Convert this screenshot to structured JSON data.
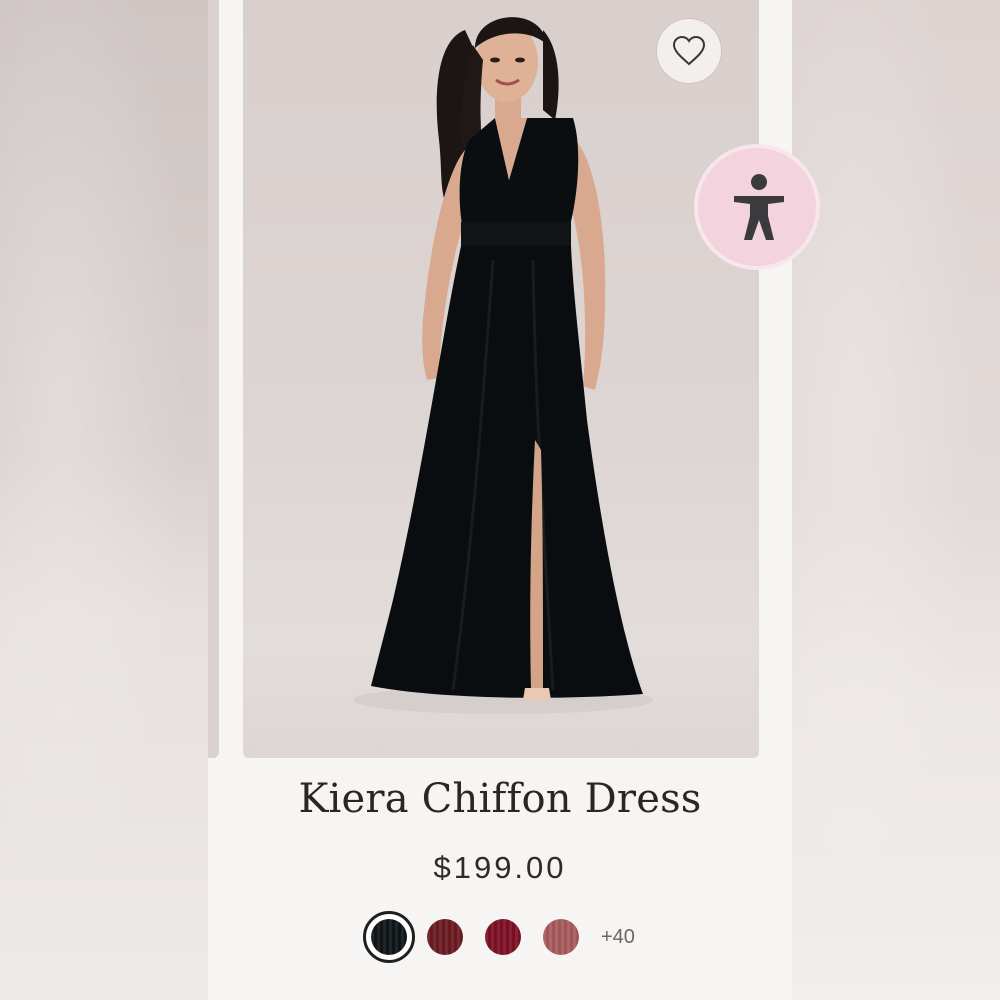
{
  "product": {
    "name": "Kiera Chiffon Dress",
    "price": "$199.00",
    "image_alt": "Model wearing a black V-neck chiffon maxi dress with front slit"
  },
  "actions": {
    "wishlist_icon": "heart-outline-icon",
    "accessibility_icon": "accessibility-person-icon"
  },
  "swatches": {
    "colors": [
      "#0f1518",
      "#6a1b22",
      "#7c1124",
      "#a95a5c"
    ],
    "selected_index": 0,
    "more_label": "+40"
  },
  "theme": {
    "accent_pink": "#f3d3dd",
    "text_dark": "#2a2626"
  }
}
